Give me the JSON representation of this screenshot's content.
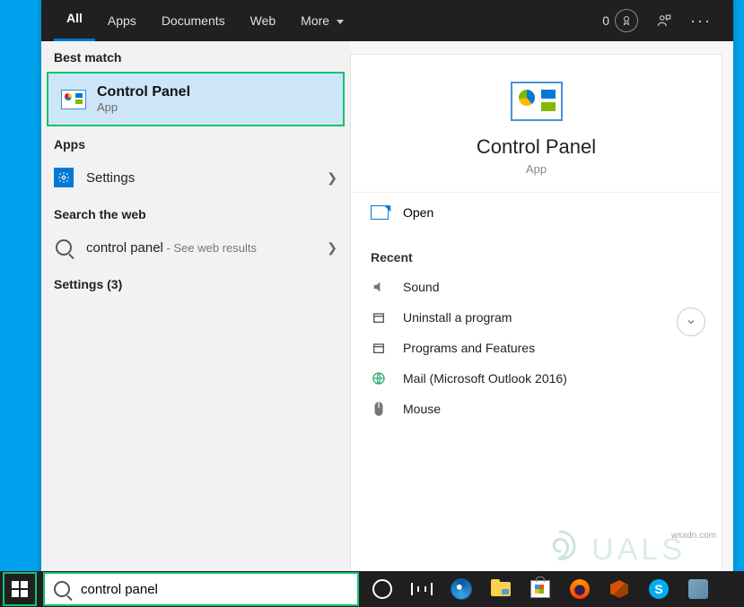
{
  "tabs": {
    "all": "All",
    "apps": "Apps",
    "documents": "Documents",
    "web": "Web",
    "more": "More"
  },
  "rewards": {
    "points": "0"
  },
  "sections": {
    "best_match": "Best match",
    "apps": "Apps",
    "search_web": "Search the web",
    "settings_count": "Settings (3)"
  },
  "best": {
    "title": "Control Panel",
    "subtitle": "App"
  },
  "apps_list": {
    "settings": "Settings"
  },
  "web": {
    "query": "control panel",
    "suffix": " - See web results"
  },
  "detail": {
    "title": "Control Panel",
    "subtitle": "App",
    "open": "Open",
    "recent_header": "Recent",
    "recent": [
      "Sound",
      "Uninstall a program",
      "Programs and Features",
      "Mail (Microsoft Outlook 2016)",
      "Mouse"
    ]
  },
  "searchbox": {
    "value": "control panel"
  },
  "watermark": "wsxdn.com",
  "watermark_ghost": "UALS"
}
